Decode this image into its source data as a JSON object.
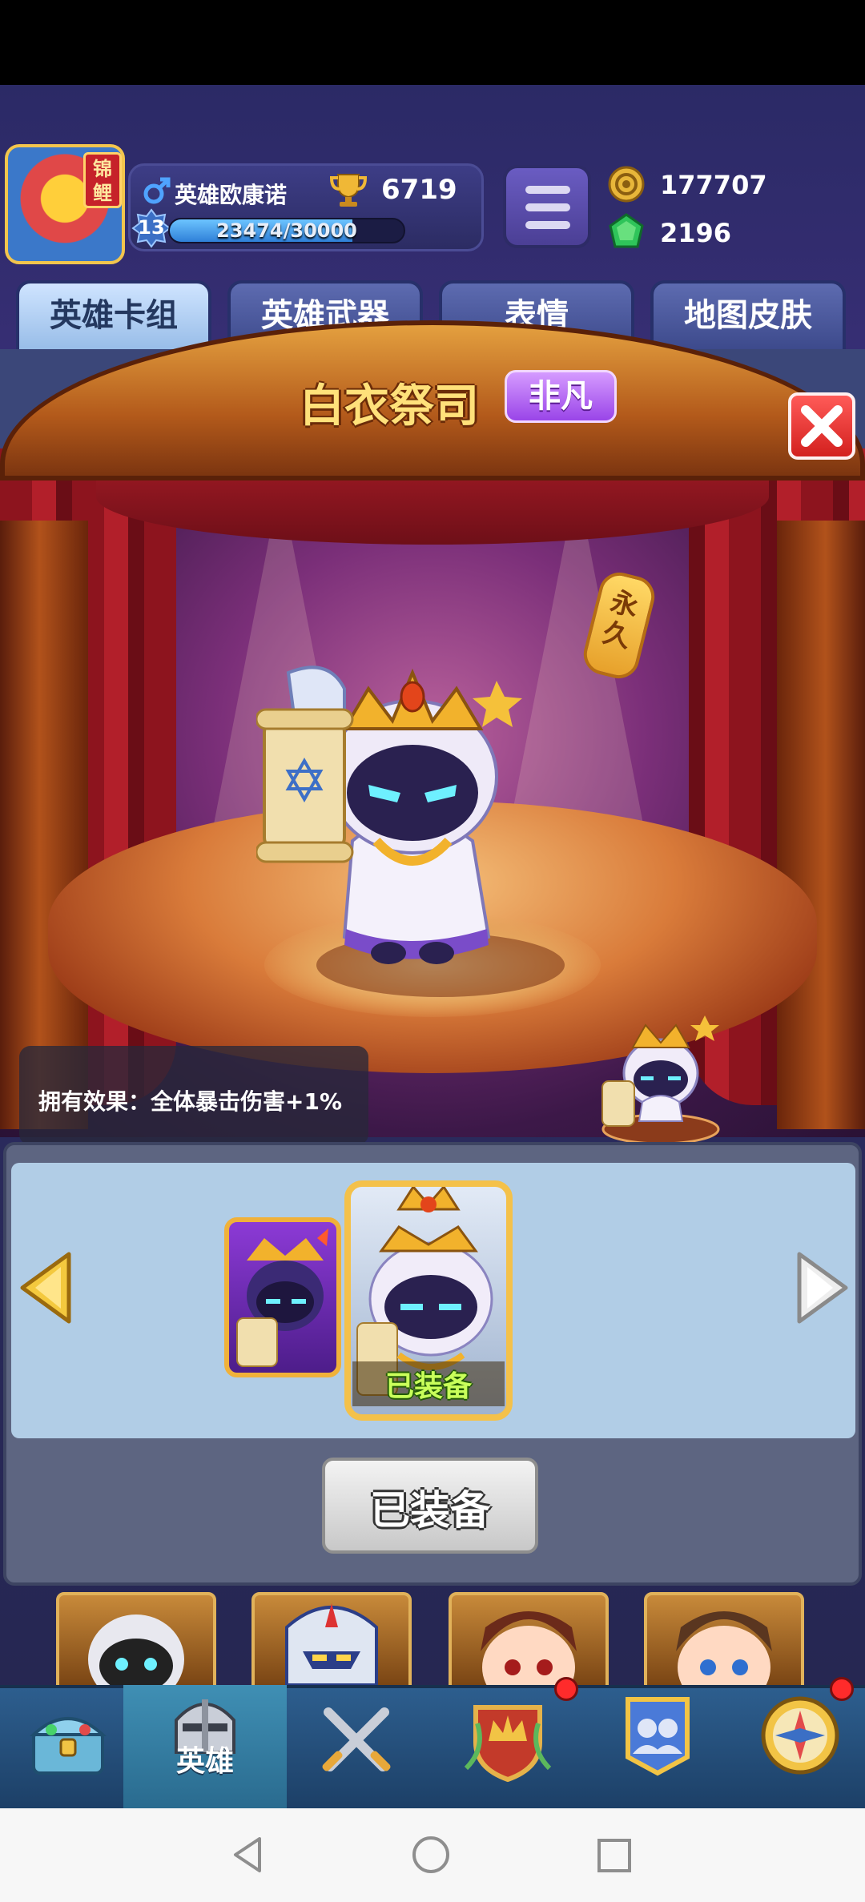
{
  "header": {
    "avatar_tag": "锦鲤",
    "player_name": "英雄欧康诺",
    "trophies": "6719",
    "level": "13",
    "xp_text": "23474/30000",
    "xp_fraction": 0.78,
    "coins": "177707",
    "gems": "2196"
  },
  "tabs": [
    {
      "label": "英雄卡组"
    },
    {
      "label": "英雄武器"
    },
    {
      "label": "表情"
    },
    {
      "label": "地图皮肤"
    }
  ],
  "popup": {
    "title": "白衣祭司",
    "rarity": "非凡",
    "permanent_tag": "永久",
    "effect": "拥有效果：全体暴击伤害+1%"
  },
  "skins": {
    "equipped_label": "已装备",
    "button_label": "已装备"
  },
  "bottom_nav": {
    "active_label": "英雄"
  },
  "colors": {
    "rarity": "#b066f0",
    "close": "#e2322f",
    "equipped_text": "#c9ff5a"
  }
}
